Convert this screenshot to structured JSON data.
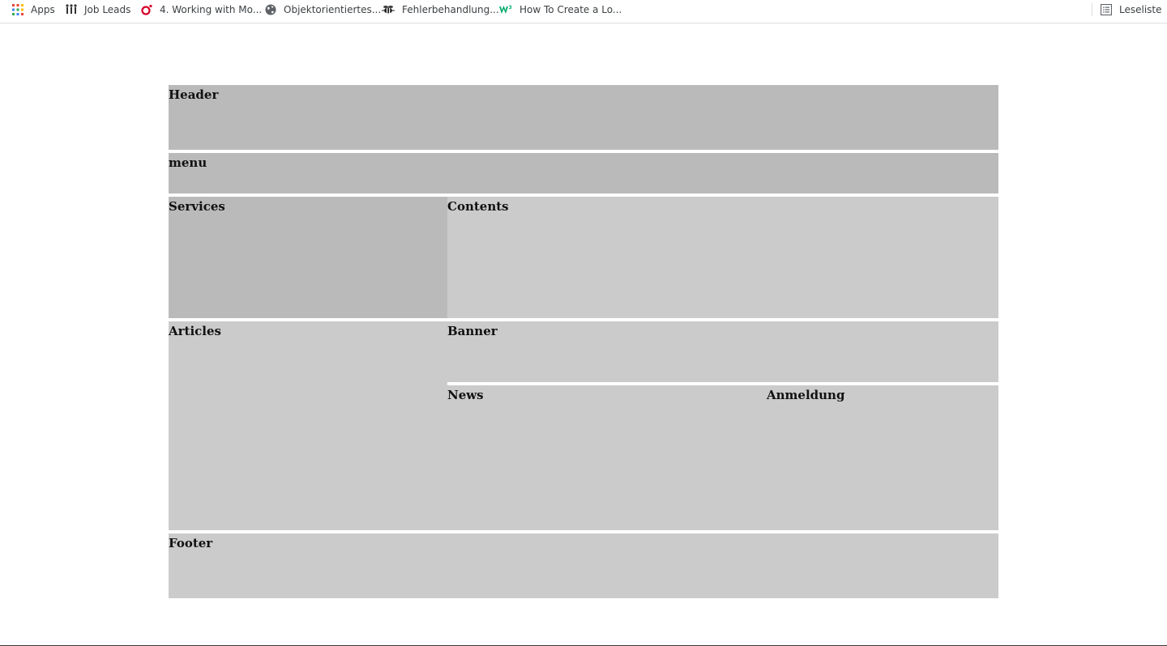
{
  "bookmarks": {
    "apps": {
      "label": "Apps",
      "icon": "apps-grid-icon"
    },
    "items": [
      {
        "label": "Job Leads",
        "icon": "people-icon"
      },
      {
        "label": "4. Working with Mo...",
        "icon": "o-logo-icon"
      },
      {
        "label": "Objektorientiertes...",
        "icon": "globe-icon"
      },
      {
        "label": "Fehlerbehandlung...",
        "icon": "bee-icon"
      },
      {
        "label": "How To Create a Lo...",
        "icon": "w3-icon"
      }
    ],
    "reading_list": {
      "label": "Leseliste",
      "icon": "reading-list-icon"
    }
  },
  "layout": {
    "header": "Header",
    "menu": "menu",
    "services": "Services",
    "contents": "Contents",
    "articles": "Articles",
    "banner": "Banner",
    "news": "News",
    "anmeldung": "Anmeldung",
    "footer": "Footer"
  },
  "colors": {
    "block_dark": "#bababa",
    "block_light": "#cbcbcb",
    "page_bg": "#ffffff"
  }
}
